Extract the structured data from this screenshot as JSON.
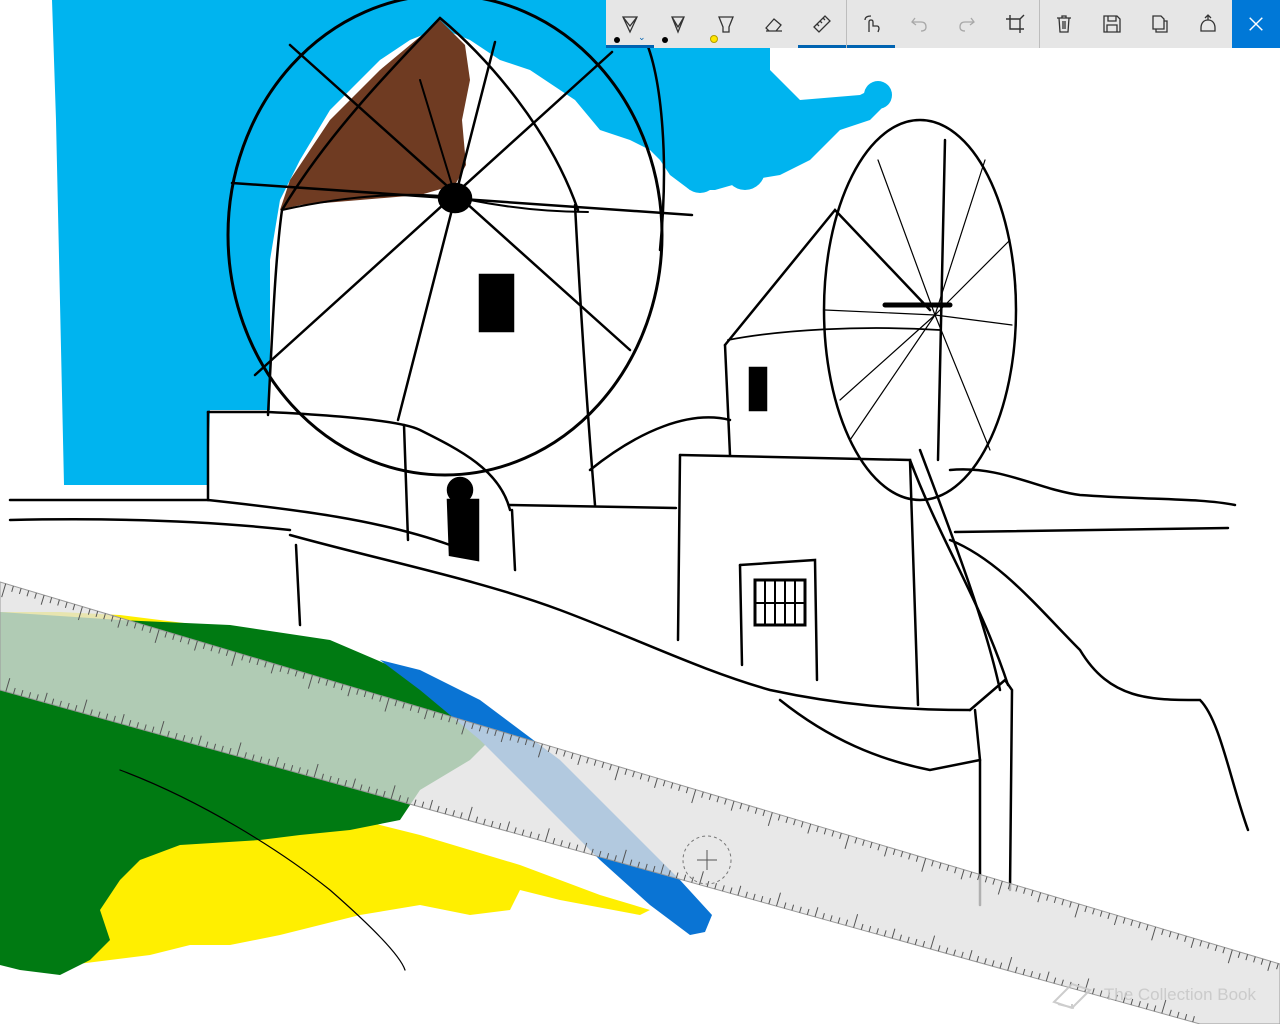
{
  "toolbar": {
    "tools": [
      {
        "name": "ballpoint-pen",
        "icon": "ballpoint-pen-icon",
        "color": "#000000",
        "selected": true
      },
      {
        "name": "pencil",
        "icon": "pencil-icon",
        "color": "#000000"
      },
      {
        "name": "highlighter",
        "icon": "highlighter-icon",
        "color": "#ffe600"
      },
      {
        "name": "eraser",
        "icon": "eraser-icon"
      },
      {
        "name": "ruler",
        "icon": "ruler-icon",
        "active": true
      },
      {
        "name": "touch-writing",
        "icon": "touch-writing-icon",
        "active": true
      },
      {
        "name": "undo",
        "icon": "undo-icon",
        "disabled": true
      },
      {
        "name": "redo",
        "icon": "redo-icon",
        "disabled": true
      },
      {
        "name": "crop",
        "icon": "crop-icon"
      },
      {
        "name": "clear-ink",
        "icon": "trash-icon"
      },
      {
        "name": "save",
        "icon": "save-icon"
      },
      {
        "name": "copy",
        "icon": "copy-icon"
      },
      {
        "name": "share",
        "icon": "share-icon"
      },
      {
        "name": "close",
        "icon": "close-icon"
      }
    ]
  },
  "colors": {
    "sky": "#00b4ef",
    "roof": "#6f3b22",
    "grass": "#007a12",
    "sand": "#ffef00",
    "toolbar_bg": "#e6e6e6",
    "accent": "#0078d7"
  },
  "watermark": {
    "text": "The Collection Book",
    "icon": "book-icon"
  }
}
